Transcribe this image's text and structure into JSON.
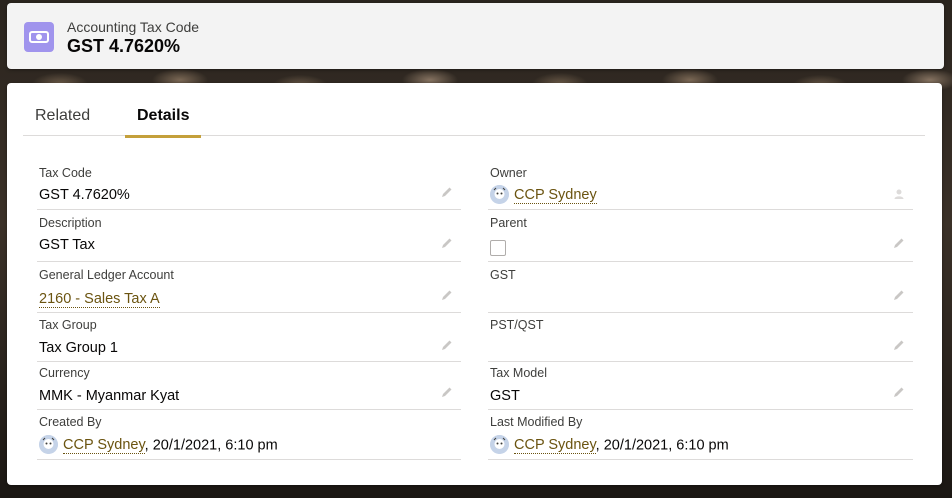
{
  "header": {
    "object_label": "Accounting Tax Code",
    "record_title": "GST 4.7620%"
  },
  "tabs": [
    {
      "label": "Related",
      "active": false
    },
    {
      "label": "Details",
      "active": true
    }
  ],
  "fields": {
    "tax_code": {
      "label": "Tax Code",
      "value": "GST 4.7620%"
    },
    "description": {
      "label": "Description",
      "value": "GST Tax"
    },
    "gl_account": {
      "label": "General Ledger Account",
      "value": "2160 - Sales Tax A"
    },
    "tax_group": {
      "label": "Tax Group",
      "value": "Tax Group 1"
    },
    "currency": {
      "label": "Currency",
      "value": "MMK - Myanmar Kyat"
    },
    "created_by": {
      "label": "Created By",
      "user": "CCP Sydney",
      "date": ", 20/1/2021, 6:10 pm"
    },
    "owner": {
      "label": "Owner",
      "value": "CCP Sydney"
    },
    "parent": {
      "label": "Parent",
      "checked": false
    },
    "gst": {
      "label": "GST",
      "value": ""
    },
    "pst_qst": {
      "label": "PST/QST",
      "value": ""
    },
    "tax_model": {
      "label": "Tax Model",
      "value": "GST"
    },
    "last_modified_by": {
      "label": "Last Modified By",
      "user": "CCP Sydney",
      "date": ", 20/1/2021, 6:10 pm"
    }
  },
  "colors": {
    "accent": "#c4a03b",
    "link": "#6b5410",
    "icon_bg": "#a094ed"
  }
}
